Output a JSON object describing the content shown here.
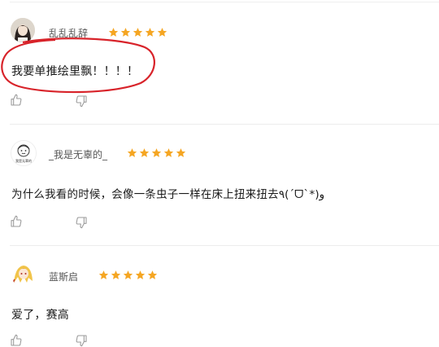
{
  "colors": {
    "star": "#f5a623",
    "annotation": "#d8232a",
    "text": "#1a1a1a",
    "divider": "#ececec"
  },
  "comments": [
    {
      "username": "乱乱乱辞",
      "stars": 5,
      "text": "我要单推绘里飘！！！！",
      "avatar": "girl-avatar"
    },
    {
      "username": "_我是无辜的_",
      "stars": 5,
      "text": "为什么我看的时候，会像一条虫子一样在床上扭来扭去٩(ˊᗜˋ*)و",
      "avatar": "cartoon-avatar",
      "avatar_caption": "我是无辜的"
    },
    {
      "username": "蓝斯启",
      "stars": 5,
      "text": "爱了，赛高",
      "avatar": "anime-avatar"
    }
  ],
  "icons": {
    "like": "thumbs-up-icon",
    "dislike": "thumbs-down-icon",
    "star": "star-icon"
  }
}
